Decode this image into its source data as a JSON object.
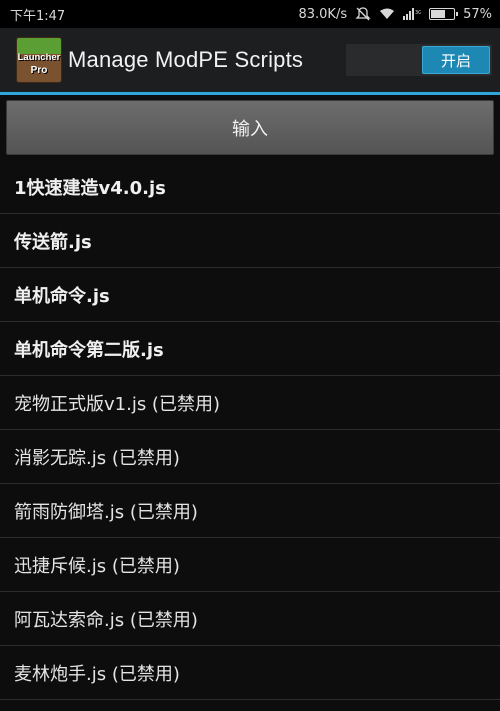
{
  "status_bar": {
    "time": "下午1:47",
    "network_speed": "83.0K/s",
    "network_type": "3G",
    "battery_percent": "57%",
    "battery_level": 0.57
  },
  "action_bar": {
    "app_icon_line1": "Launcher",
    "app_icon_line2": "Pro",
    "title": "Manage ModPE Scripts",
    "toggle_label": "开启"
  },
  "import_button": {
    "label": "输入"
  },
  "scripts": [
    {
      "label": "1快速建造v4.0.js",
      "enabled": true
    },
    {
      "label": "传送箭.js",
      "enabled": true
    },
    {
      "label": "单机命令.js",
      "enabled": true
    },
    {
      "label": "单机命令第二版.js",
      "enabled": true
    },
    {
      "label": "宠物正式版v1.js (已禁用)",
      "enabled": false
    },
    {
      "label": "消影无踪.js (已禁用)",
      "enabled": false
    },
    {
      "label": "箭雨防御塔.js (已禁用)",
      "enabled": false
    },
    {
      "label": "迅捷斥候.js (已禁用)",
      "enabled": false
    },
    {
      "label": "阿瓦达索命.js (已禁用)",
      "enabled": false
    },
    {
      "label": "麦林炮手.js (已禁用)",
      "enabled": false
    }
  ],
  "colors": {
    "accent": "#2ea7d8",
    "toggle_on": "#1e88b4",
    "background": "#0d0d0d"
  }
}
